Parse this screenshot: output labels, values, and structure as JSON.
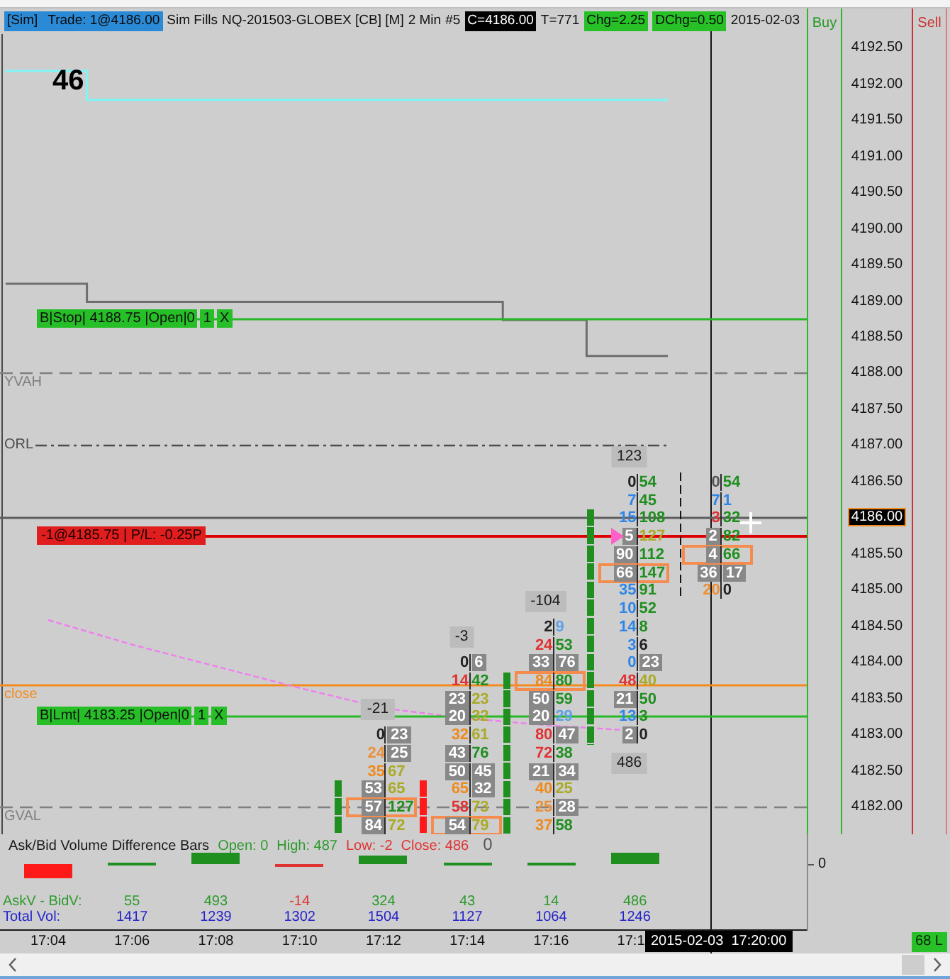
{
  "header": {
    "items": [
      {
        "text": "[Sim]",
        "kind": "highlight"
      },
      {
        "text": "Trade: 1@4186.00",
        "kind": "highlight"
      },
      {
        "text": "Sim Fills",
        "kind": "plain"
      },
      {
        "text": "NQ-201503-GLOBEX [CB] [M]",
        "kind": "plain"
      },
      {
        "text": "2 Min",
        "kind": "plain"
      },
      {
        "text": "#5",
        "kind": "plain"
      },
      {
        "text": "C=4186.00",
        "kind": "inverse"
      },
      {
        "text": "T=771",
        "kind": "plain"
      },
      {
        "text": "Chg=2.25",
        "kind": "positive"
      },
      {
        "text": "DChg=0.50",
        "kind": "positive"
      },
      {
        "text": "2015-02-03",
        "kind": "plain"
      }
    ]
  },
  "buy_column": {
    "label": "Buy"
  },
  "sell_column": {
    "label": "Sell"
  },
  "price_axis": {
    "labels": [
      {
        "text": "4192.50",
        "current": false
      },
      {
        "text": "4192.00",
        "current": false
      },
      {
        "text": "4191.50",
        "current": false
      },
      {
        "text": "4191.00",
        "current": false
      },
      {
        "text": "4190.50",
        "current": false
      },
      {
        "text": "4190.00",
        "current": false
      },
      {
        "text": "4189.50",
        "current": false
      },
      {
        "text": "4189.00",
        "current": false
      },
      {
        "text": "4188.50",
        "current": false
      },
      {
        "text": "4188.00",
        "current": false
      },
      {
        "text": "4187.50",
        "current": false
      },
      {
        "text": "4187.00",
        "current": false
      },
      {
        "text": "4186.50",
        "current": false
      },
      {
        "text": "4186.00",
        "current": true
      },
      {
        "text": "4185.50",
        "current": false
      },
      {
        "text": "4185.00",
        "current": false
      },
      {
        "text": "4184.50",
        "current": false
      },
      {
        "text": "4184.00",
        "current": false
      },
      {
        "text": "4183.50",
        "current": false
      },
      {
        "text": "4183.00",
        "current": false
      },
      {
        "text": "4182.50",
        "current": false
      },
      {
        "text": "4182.00",
        "current": false
      }
    ]
  },
  "chart": {
    "value_label": "46",
    "orders": [
      {
        "parts": [
          "B|Stop| 4188.75 |Open|0",
          "1",
          "X"
        ]
      },
      {
        "parts": [
          "B|Lmt| 4183.25 |Open|0",
          "1",
          "X"
        ]
      }
    ],
    "position": {
      "label": "-1@4185.75 | P/L: -0.25P"
    },
    "levels": [
      {
        "label": "YVAH",
        "color": "#808080"
      },
      {
        "label": "ORL",
        "color": "#4d4d4d"
      },
      {
        "label": "close",
        "color": "#f58a1f"
      },
      {
        "label": "GVAL",
        "color": "#808080"
      }
    ],
    "bars": [
      {
        "delta": "-21",
        "cells": [
          {
            "bid": {
              "text": "0",
              "color": "#222222"
            },
            "ask": {
              "text": "23",
              "color": "#ffffff"
            },
            "highlighted": false
          },
          {
            "bid": {
              "text": "24",
              "color": "#ec9038"
            },
            "ask": {
              "text": "25",
              "color": "#ffffff"
            },
            "highlighted": false
          },
          {
            "bid": {
              "text": "35",
              "color": "#ee8a1e"
            },
            "ask": {
              "text": "67",
              "color": "#aaaa28"
            },
            "highlighted": false
          },
          {
            "bid": {
              "text": "53",
              "color": "#ffffff"
            },
            "ask": {
              "text": "65",
              "color": "#aaaa28"
            },
            "highlighted": false
          },
          {
            "bid": {
              "text": "57",
              "color": "#ffffff"
            },
            "ask": {
              "text": "127",
              "color": "#1f8f1f"
            },
            "highlighted": true
          },
          {
            "bid": {
              "text": "84",
              "color": "#ffffff"
            },
            "ask": {
              "text": "72",
              "color": "#aaaa28"
            },
            "highlighted": false
          }
        ]
      },
      {
        "delta": "-3",
        "cells": [
          {
            "bid": {
              "text": "0",
              "color": "#222222"
            },
            "ask": {
              "text": "6",
              "color": "#ffffff"
            },
            "highlighted": false
          },
          {
            "bid": {
              "text": "14",
              "color": "#e03434"
            },
            "ask": {
              "text": "42",
              "color": "#1f8f1f"
            },
            "highlighted": false
          },
          {
            "bid": {
              "text": "23",
              "color": "#ffffff"
            },
            "ask": {
              "text": "23",
              "color": "#aaaa28"
            },
            "highlighted": false
          },
          {
            "bid": {
              "text": "20",
              "color": "#ffffff"
            },
            "ask": {
              "text": "32",
              "color": "#aaaa28"
            },
            "highlighted": false
          },
          {
            "bid": {
              "text": "32",
              "color": "#ee8a1e"
            },
            "ask": {
              "text": "61",
              "color": "#aaaa28"
            },
            "highlighted": false
          },
          {
            "bid": {
              "text": "43",
              "color": "#ffffff"
            },
            "ask": {
              "text": "76",
              "color": "#1f8f1f"
            },
            "highlighted": false
          },
          {
            "bid": {
              "text": "50",
              "color": "#ffffff"
            },
            "ask": {
              "text": "45",
              "color": "#ffffff"
            },
            "highlighted": false
          },
          {
            "bid": {
              "text": "65",
              "color": "#ee8a1e"
            },
            "ask": {
              "text": "32",
              "color": "#ffffff"
            },
            "highlighted": false
          },
          {
            "bid": {
              "text": "58",
              "color": "#e03434"
            },
            "ask": {
              "text": "73",
              "color": "#aaaa28"
            },
            "highlighted": false
          },
          {
            "bid": {
              "text": "54",
              "color": "#ffffff"
            },
            "ask": {
              "text": "79",
              "color": "#aaaa28"
            },
            "highlighted": true
          }
        ]
      },
      {
        "delta": "-104",
        "cells": [
          {
            "bid": {
              "text": "2",
              "color": "#222222"
            },
            "ask": {
              "text": "9",
              "color": "#5ea2e6"
            },
            "highlighted": false
          },
          {
            "bid": {
              "text": "24",
              "color": "#e03434"
            },
            "ask": {
              "text": "53",
              "color": "#1f8f1f"
            },
            "highlighted": false
          },
          {
            "bid": {
              "text": "33",
              "color": "#ffffff"
            },
            "ask": {
              "text": "76",
              "color": "#ffffff"
            },
            "highlighted": false
          },
          {
            "bid": {
              "text": "84",
              "color": "#ee8a1e"
            },
            "ask": {
              "text": "80",
              "color": "#1f8f1f"
            },
            "highlighted": true
          },
          {
            "bid": {
              "text": "50",
              "color": "#ffffff"
            },
            "ask": {
              "text": "59",
              "color": "#1f8f1f"
            },
            "highlighted": false
          },
          {
            "bid": {
              "text": "20",
              "color": "#ffffff"
            },
            "ask": {
              "text": "29",
              "color": "#5ea2e6"
            },
            "highlighted": false
          },
          {
            "bid": {
              "text": "80",
              "color": "#e03434"
            },
            "ask": {
              "text": "47",
              "color": "#ffffff"
            },
            "highlighted": false
          },
          {
            "bid": {
              "text": "72",
              "color": "#e03434"
            },
            "ask": {
              "text": "38",
              "color": "#1f8f1f"
            },
            "highlighted": false
          },
          {
            "bid": {
              "text": "21",
              "color": "#ffffff"
            },
            "ask": {
              "text": "34",
              "color": "#ffffff"
            },
            "highlighted": false
          },
          {
            "bid": {
              "text": "40",
              "color": "#ee8a1e"
            },
            "ask": {
              "text": "25",
              "color": "#aaaa28"
            },
            "highlighted": false
          },
          {
            "bid": {
              "text": "25",
              "color": "#ec9038"
            },
            "ask": {
              "text": "28",
              "color": "#ffffff"
            },
            "highlighted": false
          },
          {
            "bid": {
              "text": "37",
              "color": "#ee8a1e"
            },
            "ask": {
              "text": "58",
              "color": "#1f8f1f"
            },
            "highlighted": false
          }
        ]
      },
      {
        "delta": "123",
        "bottom_delta": "486",
        "cells": [
          {
            "bid": {
              "text": "0",
              "color": "#222222"
            },
            "ask": {
              "text": "54",
              "color": "#1f8f1f"
            },
            "highlighted": false
          },
          {
            "bid": {
              "text": "7",
              "color": "#2f86e8"
            },
            "ask": {
              "text": "45",
              "color": "#1f8f1f"
            },
            "highlighted": false
          },
          {
            "bid": {
              "text": "15",
              "color": "#2f86e8"
            },
            "ask": {
              "text": "108",
              "color": "#1f8f1f"
            },
            "highlighted": false
          },
          {
            "bid": {
              "text": "5",
              "color": "#ffffff"
            },
            "ask": {
              "text": "127",
              "color": "#aaaa28"
            },
            "highlighted": false
          },
          {
            "bid": {
              "text": "90",
              "color": "#ffffff"
            },
            "ask": {
              "text": "112",
              "color": "#1f8f1f"
            },
            "highlighted": false
          },
          {
            "bid": {
              "text": "66",
              "color": "#ffffff"
            },
            "ask": {
              "text": "147",
              "color": "#1f8f1f"
            },
            "highlighted": true
          },
          {
            "bid": {
              "text": "35",
              "color": "#2f86e8"
            },
            "ask": {
              "text": "91",
              "color": "#1f8f1f"
            },
            "highlighted": false
          },
          {
            "bid": {
              "text": "10",
              "color": "#2f86e8"
            },
            "ask": {
              "text": "52",
              "color": "#1f8f1f"
            },
            "highlighted": false
          },
          {
            "bid": {
              "text": "14",
              "color": "#2f86e8"
            },
            "ask": {
              "text": "8",
              "color": "#1f8f1f"
            },
            "highlighted": false
          },
          {
            "bid": {
              "text": "3",
              "color": "#2f86e8"
            },
            "ask": {
              "text": "6",
              "color": "#222222"
            },
            "highlighted": false
          },
          {
            "bid": {
              "text": "0",
              "color": "#2f86e8"
            },
            "ask": {
              "text": "23",
              "color": "#ffffff"
            },
            "highlighted": false
          },
          {
            "bid": {
              "text": "48",
              "color": "#e03434"
            },
            "ask": {
              "text": "40",
              "color": "#aaaa28"
            },
            "highlighted": false
          },
          {
            "bid": {
              "text": "21",
              "color": "#ffffff"
            },
            "ask": {
              "text": "50",
              "color": "#1f8f1f"
            },
            "highlighted": false
          },
          {
            "bid": {
              "text": "13",
              "color": "#2f86e8"
            },
            "ask": {
              "text": "3",
              "color": "#1f8f1f"
            },
            "highlighted": false
          },
          {
            "bid": {
              "text": "2",
              "color": "#ffffff"
            },
            "ask": {
              "text": "0",
              "color": "#222222"
            },
            "highlighted": false
          }
        ]
      },
      {
        "cells": [
          {
            "bid": {
              "text": "0",
              "color": "#555555"
            },
            "ask": {
              "text": "54",
              "color": "#1f8f1f"
            },
            "highlighted": false
          },
          {
            "bid": {
              "text": "7",
              "color": "#2f86e8"
            },
            "ask": {
              "text": "1",
              "color": "#2f86e8"
            },
            "highlighted": false
          },
          {
            "bid": {
              "text": "3",
              "color": "#e03434"
            },
            "ask": {
              "text": "32",
              "color": "#1f8f1f"
            },
            "highlighted": false
          },
          {
            "bid": {
              "text": "2",
              "color": "#ffffff"
            },
            "ask": {
              "text": "82",
              "color": "#1f8f1f"
            },
            "highlighted": false
          },
          {
            "bid": {
              "text": "4",
              "color": "#ffffff"
            },
            "ask": {
              "text": "66",
              "color": "#1f8f1f"
            },
            "highlighted": true
          },
          {
            "bid": {
              "text": "36",
              "color": "#ffffff"
            },
            "ask": {
              "text": "17",
              "color": "#ffffff"
            },
            "highlighted": false
          },
          {
            "bid": {
              "text": "20",
              "color": "#ec9038"
            },
            "ask": {
              "text": "0",
              "color": "#222222"
            },
            "highlighted": false
          }
        ]
      }
    ]
  },
  "indicator": {
    "title": "Ask/Bid Volume Difference Bars",
    "stats": [
      {
        "text": "Open: 0",
        "color": "#2e9a2e"
      },
      {
        "text": "High: 487",
        "color": "#2e9a2e"
      },
      {
        "text": "Low: -2",
        "color": "#e03434"
      },
      {
        "text": "Close: 486",
        "color": "#e03434"
      }
    ],
    "current_value": "0",
    "axis_label": "0",
    "rows": [
      {
        "label": "AskV - BidV:",
        "color": "#2e9a2e",
        "values": [
          {
            "text": "55",
            "color": "#2e9a2e"
          },
          {
            "text": "493",
            "color": "#2e9a2e"
          },
          {
            "text": "-14",
            "color": "#e03434"
          },
          {
            "text": "324",
            "color": "#2e9a2e"
          },
          {
            "text": "43",
            "color": "#2e9a2e"
          },
          {
            "text": "14",
            "color": "#2e9a2e"
          },
          {
            "text": "486",
            "color": "#2e9a2e"
          }
        ]
      },
      {
        "label": "Total Vol:",
        "color": "#2424cc",
        "values": [
          "1417",
          "1239",
          "1302",
          "1504",
          "1127",
          "1064",
          "1246"
        ]
      }
    ]
  },
  "time_axis": {
    "labels": [
      "17:04",
      "17:06",
      "17:08",
      "17:10",
      "17:12",
      "17:14",
      "17:16",
      "17:1"
    ],
    "cursor_time": "2015-02-03  17:20:00"
  },
  "status": {
    "tick_counter": "68 L"
  }
}
